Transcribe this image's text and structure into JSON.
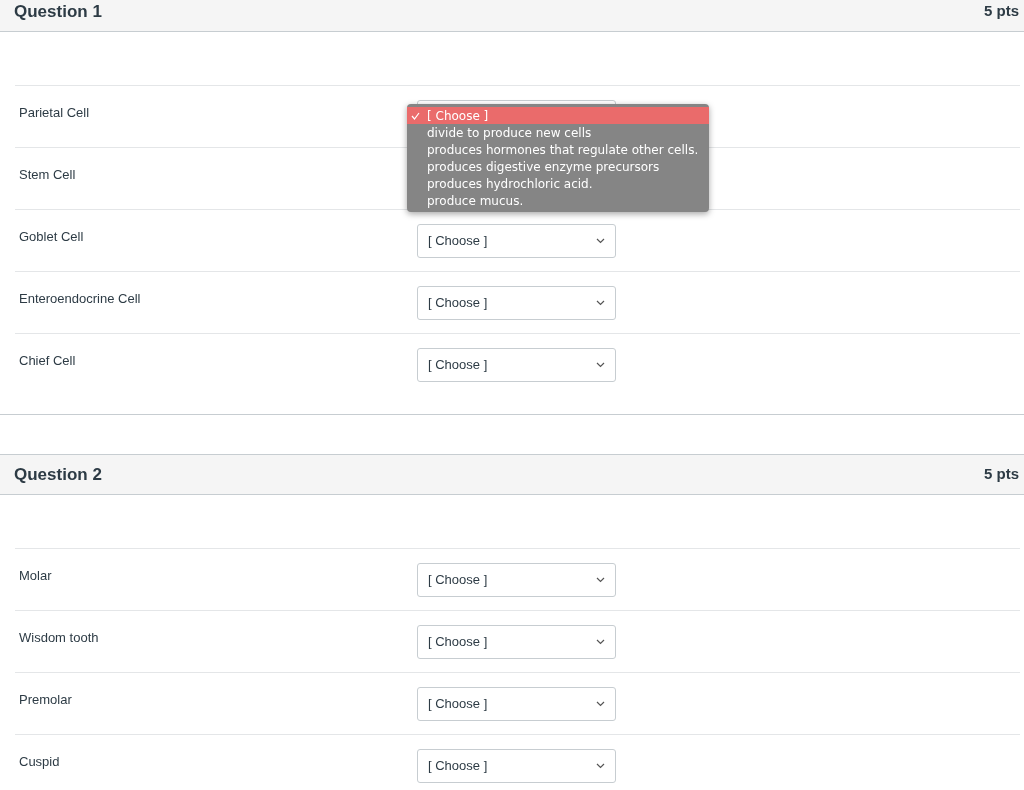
{
  "questions": [
    {
      "title": "Question 1",
      "points": "5 pts",
      "rows": [
        {
          "label": "Parietal Cell",
          "menu": [
            {
              "text": "[ Choose ]",
              "selected": true
            },
            {
              "text": "divide to produce new cells",
              "selected": false
            },
            {
              "text": "produces hormones that regulate other cells.",
              "selected": false
            },
            {
              "text": "produces digestive enzyme precursors",
              "selected": false
            },
            {
              "text": "produces hydrochloric acid.",
              "selected": false
            },
            {
              "text": "produce mucus.",
              "selected": false
            }
          ]
        },
        {
          "label": "Stem Cell"
        },
        {
          "label": "Goblet Cell",
          "value": "[ Choose ]"
        },
        {
          "label": "Enteroendocrine Cell",
          "value": "[ Choose ]"
        },
        {
          "label": "Chief Cell",
          "value": "[ Choose ]"
        }
      ]
    },
    {
      "title": "Question 2",
      "points": "5 pts",
      "rows": [
        {
          "label": "Molar",
          "value": "[ Choose ]"
        },
        {
          "label": "Wisdom tooth",
          "value": "[ Choose ]"
        },
        {
          "label": "Premolar",
          "value": "[ Choose ]"
        },
        {
          "label": "Cuspid",
          "value": "[ Choose ]"
        }
      ]
    }
  ]
}
